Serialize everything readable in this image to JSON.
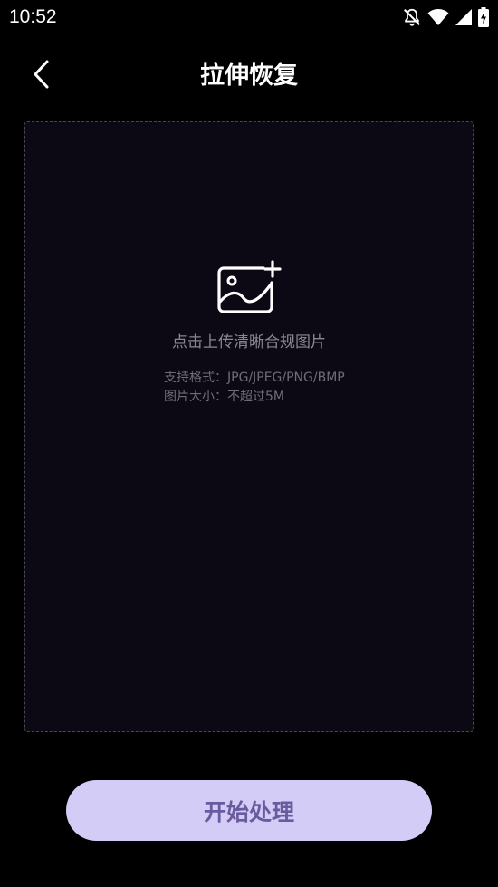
{
  "status_bar": {
    "time": "10:52",
    "icons": [
      "bell-off-icon",
      "wifi-icon",
      "cellular-signal-icon",
      "battery-charging-icon"
    ]
  },
  "nav": {
    "back_icon": "chevron-left-icon",
    "title": "拉伸恢复"
  },
  "upload": {
    "icon": "image-add-icon",
    "hint": "点击上传清晰合规图片",
    "formats": "支持格式：JPG/JPEG/PNG/BMP",
    "size_limit": "图片大小：不超过5M"
  },
  "actions": {
    "start_label": "开始处理"
  },
  "colors": {
    "background": "#000000",
    "upload_area_bg": "#0c0914",
    "button_bg": "#d3ccf6",
    "button_text": "#6a5a9e"
  }
}
